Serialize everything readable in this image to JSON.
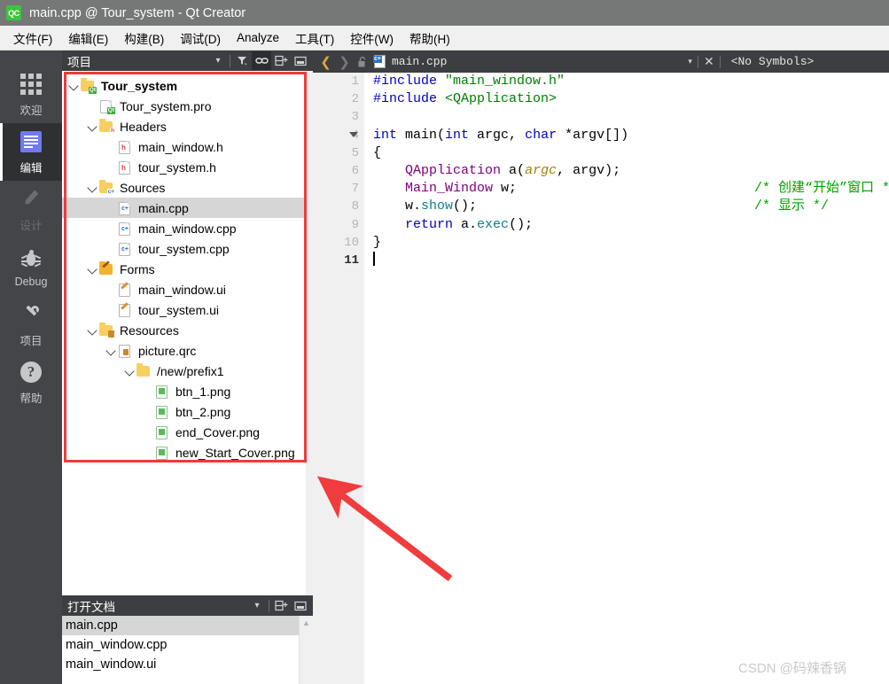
{
  "window": {
    "logo_text": "QC",
    "title": "main.cpp @ Tour_system - Qt Creator"
  },
  "menubar": {
    "items": [
      {
        "label": "文件(F)",
        "mnemonic": "F"
      },
      {
        "label": "编辑(E)",
        "mnemonic": "E"
      },
      {
        "label": "构建(B)",
        "mnemonic": "B"
      },
      {
        "label": "调试(D)",
        "mnemonic": "D"
      },
      {
        "label": "Analyze",
        "mnemonic": "A"
      },
      {
        "label": "工具(T)",
        "mnemonic": "T"
      },
      {
        "label": "控件(W)",
        "mnemonic": "W"
      },
      {
        "label": "帮助(H)",
        "mnemonic": "H"
      }
    ]
  },
  "rail": {
    "items": [
      {
        "label": "欢迎",
        "icon": "grid-icon",
        "state": "normal"
      },
      {
        "label": "编辑",
        "icon": "edit-document-icon",
        "state": "active"
      },
      {
        "label": "设计",
        "icon": "pencil-icon",
        "state": "disabled"
      },
      {
        "label": "Debug",
        "icon": "bug-icon",
        "state": "normal"
      },
      {
        "label": "项目",
        "icon": "wrench-icon",
        "state": "normal"
      },
      {
        "label": "帮助",
        "icon": "question-mark-icon",
        "state": "normal"
      }
    ]
  },
  "project_panel": {
    "title": "项目",
    "toolbar": {
      "dropdown": "▾",
      "filter_icon": "filter-funnel-icon",
      "link_icon": "link-sync-icon",
      "split_icon": "split-add-icon",
      "minimize_icon": "minimize-icon"
    },
    "tree": [
      {
        "label": "Tour_system",
        "indent": 0,
        "icon": "qt-project-folder-icon",
        "chevron": "open",
        "bold": true,
        "selected": false
      },
      {
        "label": "Tour_system.pro",
        "indent": 1,
        "icon": "qt-pro-file-icon",
        "chevron": "none",
        "bold": false,
        "selected": false
      },
      {
        "label": "Headers",
        "indent": 1,
        "icon": "headers-folder-icon",
        "chevron": "open",
        "bold": false,
        "selected": false
      },
      {
        "label": "main_window.h",
        "indent": 2,
        "icon": "h-file-icon",
        "chevron": "none",
        "bold": false,
        "selected": false
      },
      {
        "label": "tour_system.h",
        "indent": 2,
        "icon": "h-file-icon",
        "chevron": "none",
        "bold": false,
        "selected": false
      },
      {
        "label": "Sources",
        "indent": 1,
        "icon": "sources-folder-icon",
        "chevron": "open",
        "bold": false,
        "selected": false
      },
      {
        "label": "main.cpp",
        "indent": 2,
        "icon": "cpp-file-icon",
        "chevron": "none",
        "bold": false,
        "selected": true
      },
      {
        "label": "main_window.cpp",
        "indent": 2,
        "icon": "cpp-file-icon",
        "chevron": "none",
        "bold": false,
        "selected": false
      },
      {
        "label": "tour_system.cpp",
        "indent": 2,
        "icon": "cpp-file-icon",
        "chevron": "none",
        "bold": false,
        "selected": false
      },
      {
        "label": "Forms",
        "indent": 1,
        "icon": "forms-folder-icon",
        "chevron": "open",
        "bold": false,
        "selected": false
      },
      {
        "label": "main_window.ui",
        "indent": 2,
        "icon": "ui-file-icon",
        "chevron": "none",
        "bold": false,
        "selected": false
      },
      {
        "label": "tour_system.ui",
        "indent": 2,
        "icon": "ui-file-icon",
        "chevron": "none",
        "bold": false,
        "selected": false
      },
      {
        "label": "Resources",
        "indent": 1,
        "icon": "resources-folder-icon",
        "chevron": "open",
        "bold": false,
        "selected": false
      },
      {
        "label": "picture.qrc",
        "indent": 2,
        "icon": "qrc-file-icon",
        "chevron": "open",
        "bold": false,
        "selected": false
      },
      {
        "label": "/new/prefix1",
        "indent": 3,
        "icon": "prefix-folder-icon",
        "chevron": "open",
        "bold": false,
        "selected": false
      },
      {
        "label": "btn_1.png",
        "indent": 4,
        "icon": "png-file-icon",
        "chevron": "none",
        "bold": false,
        "selected": false
      },
      {
        "label": "btn_2.png",
        "indent": 4,
        "icon": "png-file-icon",
        "chevron": "none",
        "bold": false,
        "selected": false
      },
      {
        "label": "end_Cover.png",
        "indent": 4,
        "icon": "png-file-icon",
        "chevron": "none",
        "bold": false,
        "selected": false
      },
      {
        "label": "new_Start_Cover.png",
        "indent": 4,
        "icon": "png-file-icon",
        "chevron": "none",
        "bold": false,
        "selected": false
      }
    ]
  },
  "open_documents": {
    "title": "打开文档",
    "toolbar": {
      "dropdown": "▾",
      "split_icon": "split-add-icon",
      "minimize_icon": "minimize-icon"
    },
    "items": [
      {
        "label": "main.cpp",
        "selected": true
      },
      {
        "label": "main_window.cpp",
        "selected": false
      },
      {
        "label": "main_window.ui",
        "selected": false
      }
    ]
  },
  "editor": {
    "toolbar": {
      "back_icon": "chevron-left-icon",
      "forward_icon": "chevron-right-icon",
      "lock_icon": "unlock-icon",
      "file_icon": "cpp-file-icon",
      "file_name": "main.cpp",
      "dropdown": "▾",
      "close_icon": "close-icon",
      "symbols": "<No Symbols>"
    },
    "line_numbers": [
      "1",
      "2",
      "3",
      "4",
      "5",
      "6",
      "7",
      "8",
      "9",
      "10",
      "11"
    ],
    "current_line": 11,
    "fold_marker_line": 4,
    "lines": [
      {
        "n": 1,
        "tokens": [
          {
            "t": "#include ",
            "c": "pre"
          },
          {
            "t": "\"main_window.h\"",
            "c": "str"
          }
        ]
      },
      {
        "n": 2,
        "tokens": [
          {
            "t": "#include ",
            "c": "pre"
          },
          {
            "t": "<QApplication>",
            "c": "str"
          }
        ]
      },
      {
        "n": 3,
        "tokens": []
      },
      {
        "n": 4,
        "tokens": [
          {
            "t": "int",
            "c": "kw"
          },
          {
            "t": " main(",
            "c": "plain"
          },
          {
            "t": "int",
            "c": "kw"
          },
          {
            "t": " argc, ",
            "c": "plain"
          },
          {
            "t": "char",
            "c": "kw"
          },
          {
            "t": " *argv[])",
            "c": "plain"
          }
        ]
      },
      {
        "n": 5,
        "tokens": [
          {
            "t": "{",
            "c": "plain"
          }
        ]
      },
      {
        "n": 6,
        "tokens": [
          {
            "t": "    ",
            "c": "plain"
          },
          {
            "t": "QApplication",
            "c": "type"
          },
          {
            "t": " a(",
            "c": "plain"
          },
          {
            "t": "argc",
            "c": "param"
          },
          {
            "t": ", argv);",
            "c": "plain"
          }
        ]
      },
      {
        "n": 7,
        "tokens": [
          {
            "t": "    ",
            "c": "plain"
          },
          {
            "t": "Main_Window",
            "c": "type"
          },
          {
            "t": " w;",
            "c": "plain"
          }
        ],
        "comment": "/* 创建“开始”窗口 */"
      },
      {
        "n": 8,
        "tokens": [
          {
            "t": "    w.",
            "c": "plain"
          },
          {
            "t": "show",
            "c": "mem"
          },
          {
            "t": "();",
            "c": "plain"
          }
        ],
        "comment": "/* 显示 */"
      },
      {
        "n": 9,
        "tokens": [
          {
            "t": "    ",
            "c": "plain"
          },
          {
            "t": "return",
            "c": "kw"
          },
          {
            "t": " a.",
            "c": "plain"
          },
          {
            "t": "exec",
            "c": "mem"
          },
          {
            "t": "();",
            "c": "plain"
          }
        ]
      },
      {
        "n": 10,
        "tokens": [
          {
            "t": "}",
            "c": "plain"
          }
        ]
      },
      {
        "n": 11,
        "tokens": [],
        "caret": true
      }
    ]
  },
  "annotation": {
    "arrow_color": "#f03c3c",
    "highlight_box_color": "#ee3b3b"
  },
  "watermark": {
    "text": "CSDN @码辣香锅"
  }
}
